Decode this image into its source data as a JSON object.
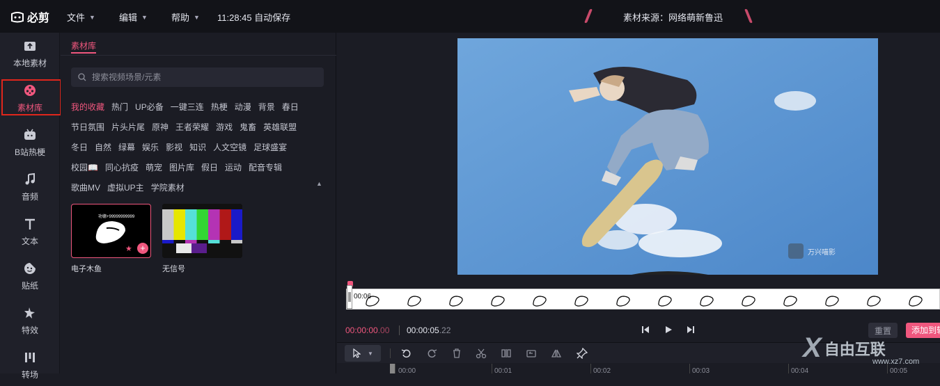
{
  "app": {
    "name": "必剪",
    "menus": [
      {
        "label": "文件"
      },
      {
        "label": "编辑"
      },
      {
        "label": "帮助"
      }
    ],
    "autosave": "11:28:45 自动保存",
    "source_note": "素材来源：网络萌新鲁迅"
  },
  "rail": [
    {
      "label": "本地素材",
      "icon": "upload-folder-icon"
    },
    {
      "label": "素材库",
      "icon": "film-reel-icon",
      "active": true
    },
    {
      "label": "B站热梗",
      "icon": "bilibili-tv-icon"
    },
    {
      "label": "音频",
      "icon": "music-note-icon"
    },
    {
      "label": "文本",
      "icon": "text-t-icon"
    },
    {
      "label": "贴纸",
      "icon": "sticker-face-icon"
    },
    {
      "label": "特效",
      "icon": "sparkle-star-icon"
    },
    {
      "label": "转场",
      "icon": "transition-bars-icon"
    }
  ],
  "library": {
    "tab": "素材库",
    "search_placeholder": "搜索视频场景/元素",
    "tag_rows": [
      [
        "我的收藏",
        "热门",
        "UP必备",
        "一键三连",
        "热梗",
        "动漫",
        "背景",
        "春日"
      ],
      [
        "节日氛围",
        "片头片尾",
        "原神",
        "王者荣耀",
        "游戏",
        "鬼畜",
        "英雄联盟"
      ],
      [
        "冬日",
        "自然",
        "绿幕",
        "娱乐",
        "影视",
        "知识",
        "人文空镜",
        "足球盛宴"
      ],
      [
        "校园📖",
        "同心抗疫",
        "萌宠",
        "图片库",
        "假日",
        "运动",
        "配音专辑"
      ],
      [
        "歌曲MV",
        "虚拟UP主",
        "学院素材"
      ]
    ],
    "active_tag": "我的收藏",
    "cards": [
      {
        "label": "电子木鱼",
        "caption": "功德+99999999999",
        "favorited": true
      },
      {
        "label": "无信号"
      }
    ]
  },
  "preview": {
    "watermark": "万兴喵影"
  },
  "strip": {
    "time": "00:06"
  },
  "playback": {
    "current": "00:00:00",
    "current_frames": ".00",
    "total": "00:00:05",
    "total_frames": ".22",
    "reset_label": "重置",
    "add_label": "添加到轨道"
  },
  "ruler": {
    "ticks": [
      "00:00",
      "00:01",
      "00:02",
      "00:03",
      "00:04",
      "00:05"
    ]
  },
  "site_watermark": {
    "text": "自由互联",
    "url": "www.xz7.com"
  },
  "colors": {
    "accent": "#f0577e",
    "highlight_box": "#e0261c"
  }
}
